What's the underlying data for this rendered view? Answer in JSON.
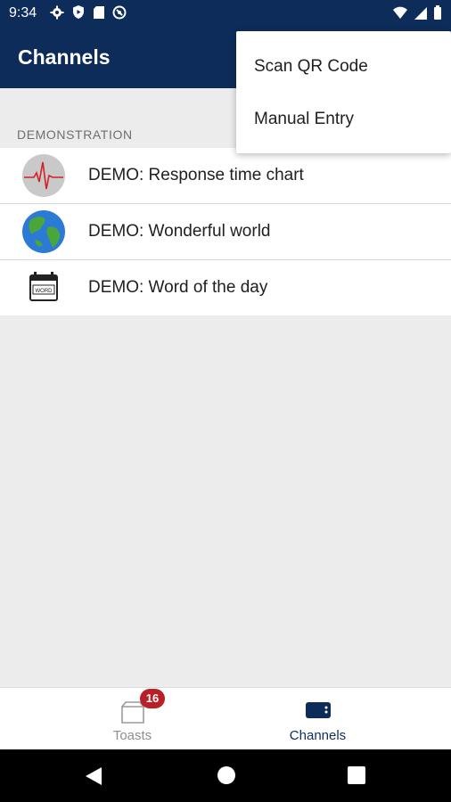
{
  "status_bar": {
    "time": "9:34",
    "left_icons": [
      "gear-icon",
      "shield-icon",
      "sdcard-icon",
      "sync-icon"
    ],
    "right_icons": [
      "wifi-icon",
      "signal-icon",
      "battery-icon"
    ]
  },
  "app_bar": {
    "title": "Channels"
  },
  "overflow_menu": {
    "items": [
      {
        "label": "Scan QR Code"
      },
      {
        "label": "Manual Entry"
      }
    ]
  },
  "section": {
    "header": "DEMONSTRATION"
  },
  "channels": [
    {
      "label": "DEMO: Response time chart",
      "icon": "heartbeat-icon"
    },
    {
      "label": "DEMO: Wonderful world",
      "icon": "globe-icon"
    },
    {
      "label": "DEMO: Word of the day",
      "icon": "calendar-word-icon"
    }
  ],
  "bottom_nav": {
    "tabs": [
      {
        "label": "Toasts",
        "badge": "16",
        "active": false
      },
      {
        "label": "Channels",
        "active": true
      }
    ]
  },
  "colors": {
    "primary": "#0d2c5a",
    "badge": "#b81f26",
    "background": "#ececec"
  }
}
